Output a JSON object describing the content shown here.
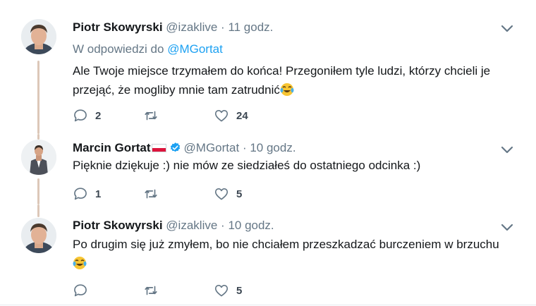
{
  "tweets": [
    {
      "name": "Piotr Skowyrski",
      "handle": "@izaklive",
      "sep": "·",
      "time": "11 godz.",
      "reply_to_prefix": "W odpowiedzi do",
      "reply_to_handle": "@MGortat",
      "text": "Ale Twoje miejsce trzymałem do końca! Przegoniłem tyle ludzi, którzy chcieli je przejąć, że mogliby mnie tam zatrudnić",
      "replies": "2",
      "retweets": "",
      "likes": "24"
    },
    {
      "name": "Marcin Gortat",
      "handle": "@MGortat",
      "sep": "·",
      "time": "10 godz.",
      "text": "Pięknie dziękuje :) nie mów ze siedziałeś do ostatniego odcinka :)",
      "replies": "1",
      "retweets": "",
      "likes": "5"
    },
    {
      "name": "Piotr Skowyrski",
      "handle": "@izaklive",
      "sep": "·",
      "time": "10 godz.",
      "text": "Po drugim się już zmyłem, bo nie chciałem przeszkadzać burczeniem w brzuchu",
      "replies": "",
      "retweets": "",
      "likes": "5"
    }
  ],
  "icons": {
    "reply": "reply-icon",
    "retweet": "retweet-icon",
    "like": "heart-icon",
    "menu": "chevron-down-icon",
    "verified": "verified-badge-icon",
    "flag": "poland-flag-icon",
    "emoji": "tears-of-joy-emoji"
  },
  "colors": {
    "link": "#1da1f2",
    "secondary_text": "#657786",
    "thread_line": "#dcc7b8",
    "verified": "#1da1f2"
  }
}
